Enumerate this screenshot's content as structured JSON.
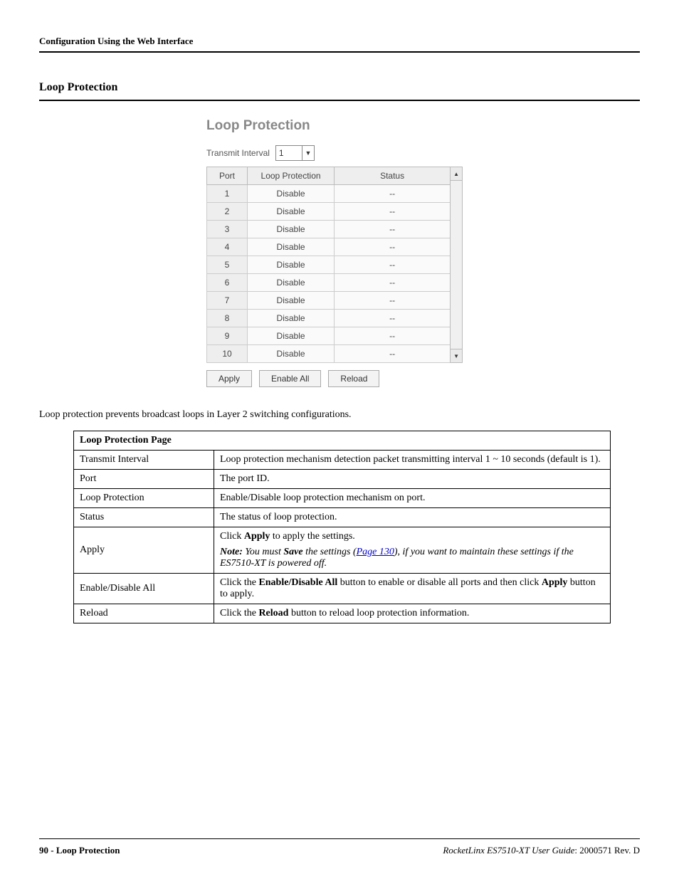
{
  "header": {
    "breadcrumb": "Configuration Using the Web Interface"
  },
  "section": {
    "title": "Loop Protection"
  },
  "ui": {
    "title": "Loop Protection",
    "transmit_label": "Transmit Interval",
    "transmit_value": "1",
    "cols": {
      "port": "Port",
      "loop": "Loop Protection",
      "status": "Status"
    },
    "rows": [
      {
        "port": "1",
        "loop": "Disable",
        "status": "--"
      },
      {
        "port": "2",
        "loop": "Disable",
        "status": "--"
      },
      {
        "port": "3",
        "loop": "Disable",
        "status": "--"
      },
      {
        "port": "4",
        "loop": "Disable",
        "status": "--"
      },
      {
        "port": "5",
        "loop": "Disable",
        "status": "--"
      },
      {
        "port": "6",
        "loop": "Disable",
        "status": "--"
      },
      {
        "port": "7",
        "loop": "Disable",
        "status": "--"
      },
      {
        "port": "8",
        "loop": "Disable",
        "status": "--"
      },
      {
        "port": "9",
        "loop": "Disable",
        "status": "--"
      },
      {
        "port": "10",
        "loop": "Disable",
        "status": "--"
      }
    ],
    "buttons": {
      "apply": "Apply",
      "enable_all": "Enable All",
      "reload": "Reload"
    }
  },
  "intro": "Loop protection prevents broadcast loops in Layer 2 switching configurations.",
  "doc": {
    "head": "Loop Protection Page",
    "transmit": {
      "label": "Transmit Interval",
      "desc": "Loop protection mechanism detection packet transmitting interval 1 ~ 10 seconds (default is 1)."
    },
    "port": {
      "label": "Port",
      "desc": "The port ID."
    },
    "loop": {
      "label": "Loop Protection",
      "desc": "Enable/Disable loop protection mechanism on port."
    },
    "status": {
      "label": "Status",
      "desc": "The status of loop protection."
    },
    "apply": {
      "label": "Apply",
      "line1_pre": "Click ",
      "line1_bold": "Apply",
      "line1_post": " to apply the settings.",
      "note_label": "Note:",
      "note_pre": " You must ",
      "note_bold": "Save",
      "note_mid": " the settings (",
      "note_link": "Page 130",
      "note_post": "), if you want to maintain these settings if the ES7510-XT is powered off."
    },
    "enable": {
      "label": "Enable/Disable All",
      "pre": "Click the ",
      "bold1": "Enable/Disable All",
      "mid": " button to enable or disable all ports and then click ",
      "bold2": "Apply",
      "post": " button to apply."
    },
    "reload": {
      "label": "Reload",
      "pre": "Click the ",
      "bold": "Reload",
      "post": " button to reload loop protection information."
    }
  },
  "footer": {
    "left": "90 - Loop Protection",
    "right_em": "RocketLinx ES7510-XT  User Guide",
    "right_post": ": 2000571 Rev. D"
  }
}
